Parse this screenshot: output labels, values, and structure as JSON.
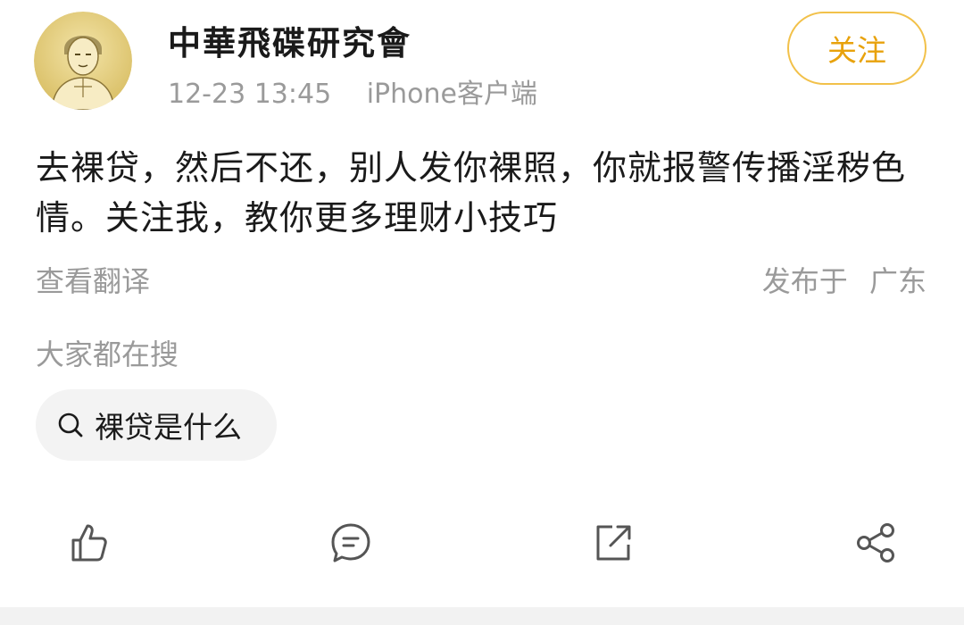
{
  "post": {
    "author": "中華飛碟研究會",
    "time": "12-23 13:45",
    "client": "iPhone客户端",
    "follow_label": "关注",
    "content": "去裸贷，然后不还，别人发你裸照，你就报警传播淫秽色情。关注我，教你更多理财小技巧",
    "translate_label": "查看翻译",
    "location_label": "发布于",
    "location_value": "广东"
  },
  "search": {
    "heading": "大家都在搜",
    "chip_label": "裸贷是什么"
  },
  "actions": {
    "icons": [
      "thumbs-up-icon",
      "comment-icon",
      "share-external-icon",
      "share-network-icon"
    ]
  },
  "colors": {
    "accent": "#e8a20c",
    "accent_border": "#f2c14a",
    "text": "#1a1a1a",
    "muted": "#9a9a9a",
    "chip_bg": "#f3f3f3"
  }
}
